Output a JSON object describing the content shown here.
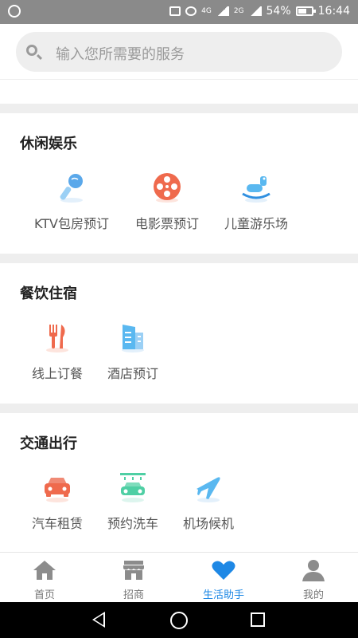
{
  "status_bar": {
    "battery": "54%",
    "time": "16:44",
    "network": "4G",
    "network2": "2G"
  },
  "search": {
    "placeholder": "输入您所需要的服务"
  },
  "sections": [
    {
      "title": "休闲娱乐",
      "items": [
        {
          "label": "KTV包房预订",
          "icon": "microphone-icon"
        },
        {
          "label": "电影票预订",
          "icon": "film-reel-icon"
        },
        {
          "label": "儿童游乐场",
          "icon": "rocking-horse-icon"
        }
      ]
    },
    {
      "title": "餐饮住宿",
      "items": [
        {
          "label": "线上订餐",
          "icon": "fork-knife-icon"
        },
        {
          "label": "酒店预订",
          "icon": "hotel-building-icon"
        }
      ]
    },
    {
      "title": "交通出行",
      "items": [
        {
          "label": "汽车租赁",
          "icon": "car-icon"
        },
        {
          "label": "预约洗车",
          "icon": "car-wash-icon"
        },
        {
          "label": "机场候机",
          "icon": "airplane-icon"
        }
      ]
    }
  ],
  "bottom_nav": [
    {
      "label": "首页",
      "icon": "home-icon"
    },
    {
      "label": "招商",
      "icon": "store-icon"
    },
    {
      "label": "生活助手",
      "icon": "heart-icon",
      "active": true
    },
    {
      "label": "我的",
      "icon": "user-icon"
    }
  ],
  "colors": {
    "accent": "#1e88e5",
    "divider": "#eeeeee",
    "statusbar": "#8a8a8a"
  }
}
